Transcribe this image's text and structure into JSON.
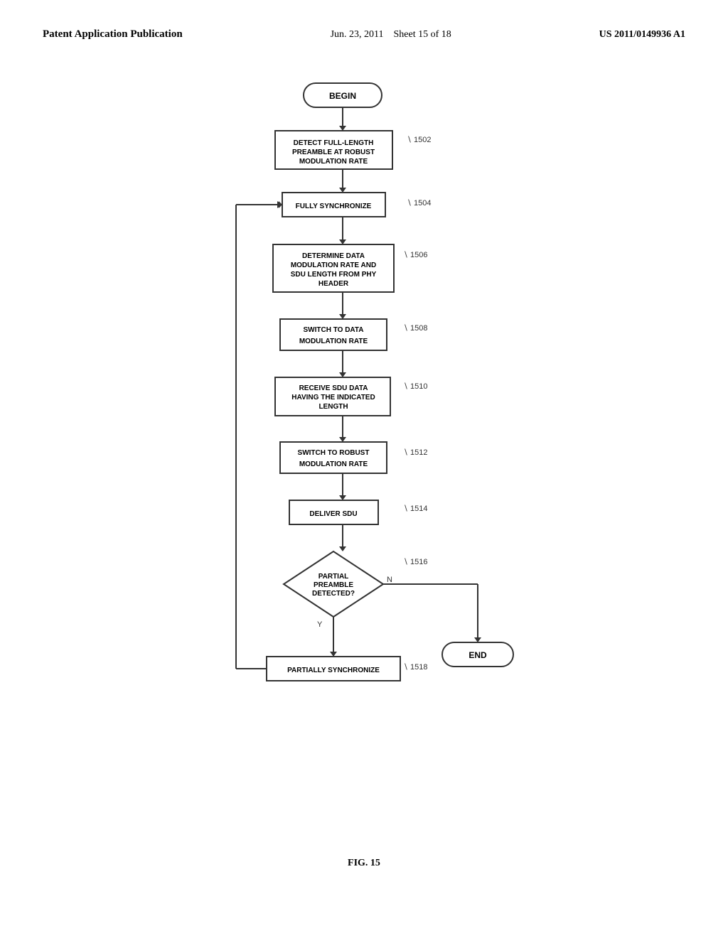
{
  "header": {
    "left": "Patent Application Publication",
    "center": "Jun. 23, 2011",
    "sheet": "Sheet 15 of 18",
    "right": "US 2011/0149936 A1"
  },
  "figure": {
    "caption": "FIG. 15",
    "nodes": [
      {
        "id": "begin",
        "type": "rounded",
        "label": "BEGIN",
        "ref": null
      },
      {
        "id": "1502",
        "type": "rect",
        "label": "DETECT FULL-LENGTH\nPREAMBLE AT ROBUST\nMODULATION RATE",
        "ref": "1502"
      },
      {
        "id": "1504",
        "type": "rect",
        "label": "FULLY SYNCHRONIZE",
        "ref": "1504"
      },
      {
        "id": "1506",
        "type": "rect",
        "label": "DETERMINE DATA\nMODULATION RATE AND\nSDU LENGTH FROM PHY\nHEADER",
        "ref": "1506"
      },
      {
        "id": "1508",
        "type": "rect",
        "label": "SWITCH TO DATA\nMODULATION RATE",
        "ref": "1508"
      },
      {
        "id": "1510",
        "type": "rect",
        "label": "RECEIVE SDU DATA\nHAVING THE INDICATED\nLENGTH",
        "ref": "1510"
      },
      {
        "id": "1512",
        "type": "rect",
        "label": "SWITCH TO ROBUST\nMODULATION RATE",
        "ref": "1512"
      },
      {
        "id": "1514",
        "type": "rect",
        "label": "DELIVER SDU",
        "ref": "1514"
      },
      {
        "id": "1516",
        "type": "diamond",
        "label": "PARTIAL\nPREAMBLE\nDETECTED?",
        "ref": "1516"
      },
      {
        "id": "1518",
        "type": "rect",
        "label": "PARTIALLY SYNCHRONIZE",
        "ref": "1518"
      },
      {
        "id": "end",
        "type": "rounded",
        "label": "END",
        "ref": null
      }
    ]
  }
}
